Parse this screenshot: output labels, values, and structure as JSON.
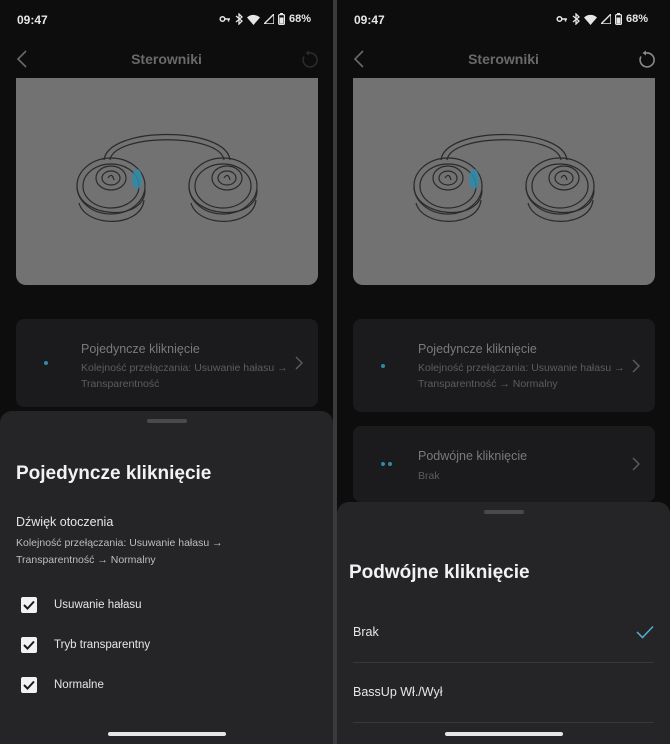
{
  "left": {
    "status": {
      "time": "09:47",
      "battery": "68%"
    },
    "nav": {
      "title": "Sterowniki"
    },
    "rows": [
      {
        "title": "Pojedyncze kliknięcie",
        "subtitle": "Kolejność przełączania: Usuwanie hałasu → Transparentność"
      }
    ],
    "sheet": {
      "title": "Pojedyncze kliknięcie",
      "section_title": "Dźwięk otoczenia",
      "description": "Kolejność przełączania: Usuwanie hałasu → Transparentność → Normalny",
      "options": [
        {
          "label": "Usuwanie hałasu",
          "checked": true
        },
        {
          "label": "Tryb transparentny",
          "checked": true
        },
        {
          "label": "Normalne",
          "checked": true
        }
      ]
    }
  },
  "right": {
    "status": {
      "time": "09:47",
      "battery": "68%"
    },
    "nav": {
      "title": "Sterowniki"
    },
    "rows": [
      {
        "title": "Pojedyncze kliknięcie",
        "subtitle": "Kolejność przełączania: Usuwanie hałasu → Transparentność → Normalny"
      },
      {
        "title": "Podwójne kliknięcie",
        "subtitle": "Brak"
      }
    ],
    "sheet": {
      "title": "Podwójne kliknięcie",
      "options": [
        {
          "label": "Brak",
          "selected": true
        },
        {
          "label": "BassUp Wł./Wył",
          "selected": false
        }
      ]
    }
  },
  "colors": {
    "accent": "#2e8ba8",
    "sheet": "#252527",
    "check": "#4fb0cf"
  },
  "icons": [
    "back-arrow-icon",
    "reset-icon",
    "wifi-icon",
    "bluetooth-icon",
    "signal-icon",
    "battery-icon",
    "vpn-key-icon",
    "chevron-right-icon",
    "checkmark-icon"
  ]
}
